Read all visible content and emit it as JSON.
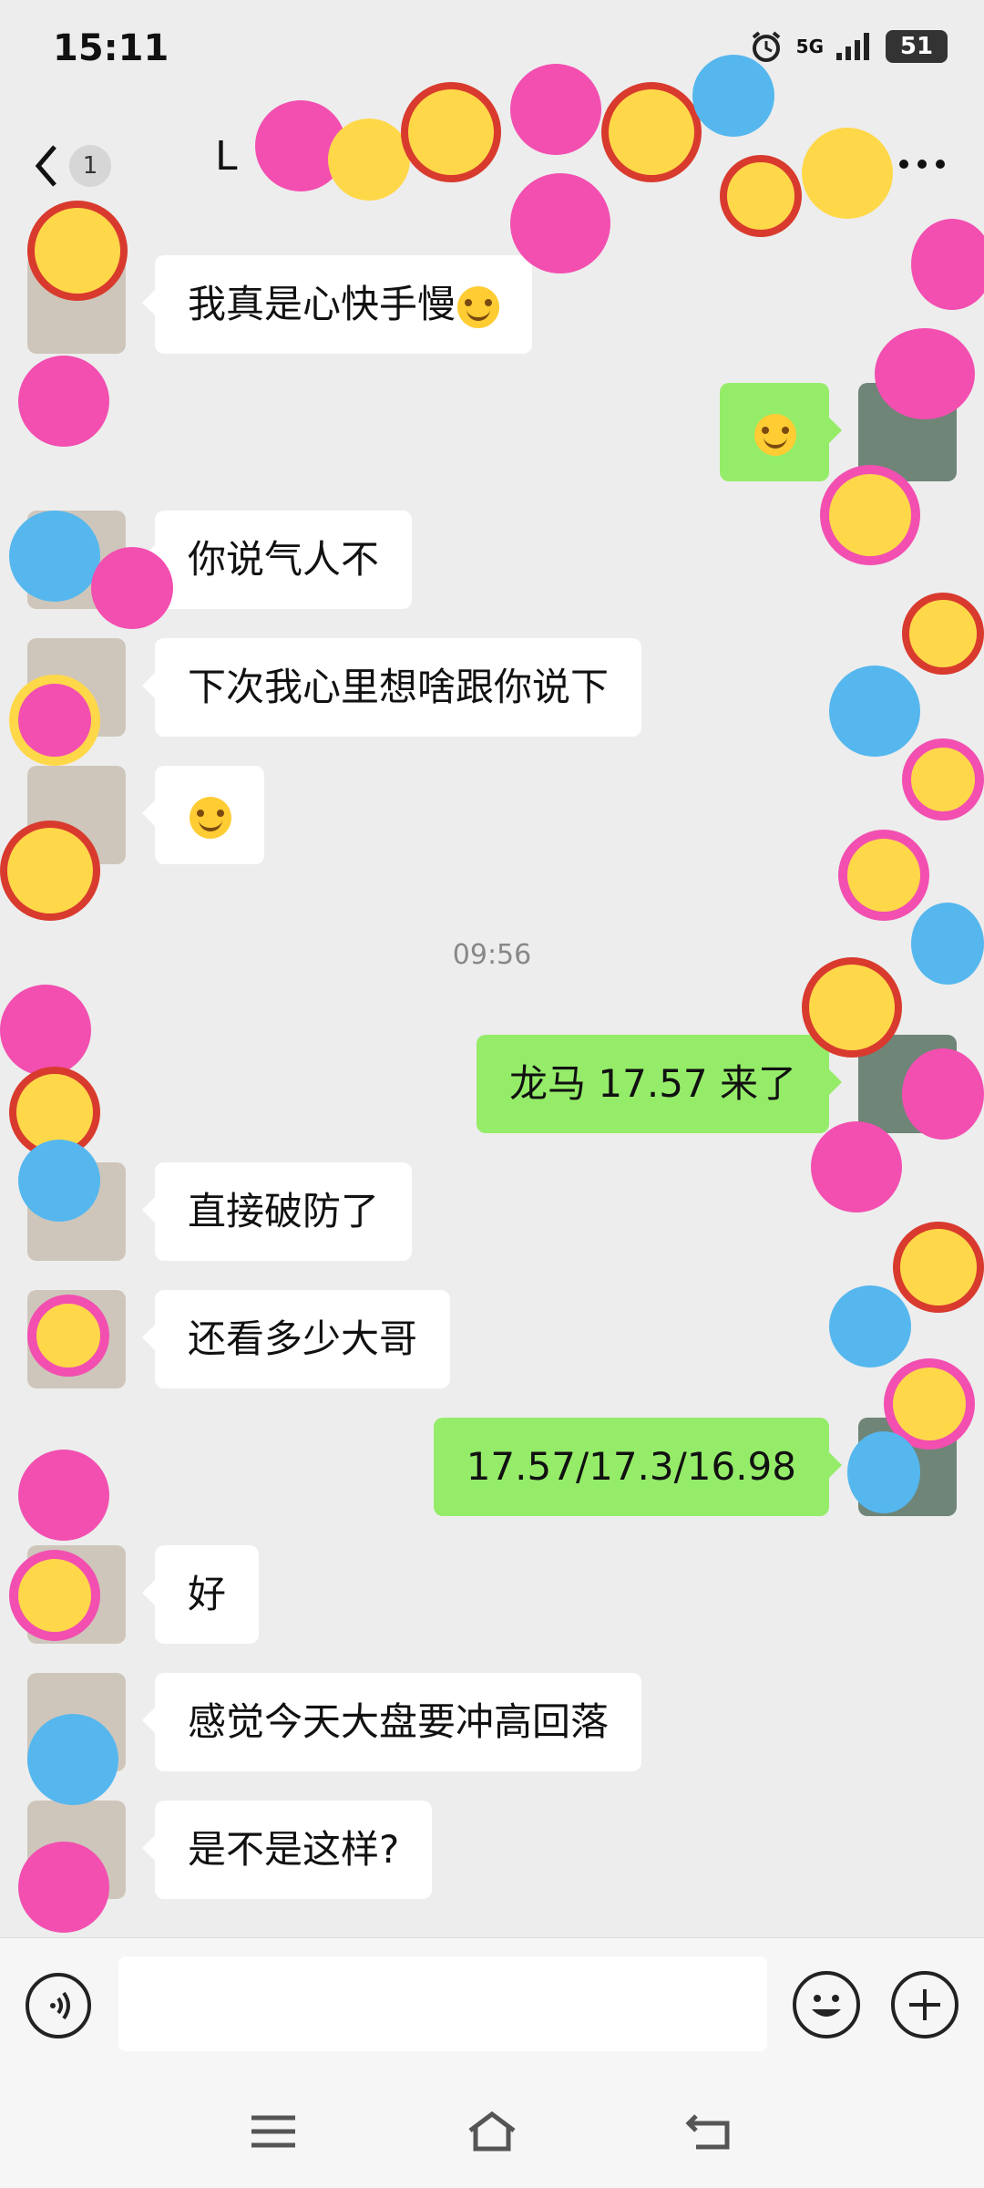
{
  "status_bar": {
    "time": "15:11",
    "network": "5G",
    "battery": "51"
  },
  "navbar": {
    "back_count": "1",
    "title": "L"
  },
  "messages": [
    {
      "side": "in",
      "text": "我真是心快手慢",
      "emoji": "laughing-crying-emoji"
    },
    {
      "side": "out",
      "text": "",
      "emoji": "laughing-crying-emoji"
    },
    {
      "side": "in",
      "text": "你说气人不"
    },
    {
      "side": "in",
      "text": "下次我心里想啥跟你说下"
    },
    {
      "side": "in",
      "text": "",
      "emoji": "laughing-crying-emoji"
    },
    {
      "side": "out",
      "text": "龙马 17.57 来了"
    },
    {
      "side": "in",
      "text": "直接破防了"
    },
    {
      "side": "in",
      "text": "还看多少大哥"
    },
    {
      "side": "out",
      "text": "17.57/17.3/16.98"
    },
    {
      "side": "in",
      "text": "好"
    },
    {
      "side": "in",
      "text": "感觉今天大盘要冲高回落"
    },
    {
      "side": "in",
      "text": "是不是这样?"
    }
  ],
  "timestamp": "09:56",
  "colors": {
    "background": "#ededed",
    "outgoing_bubble": "#95ec69",
    "incoming_bubble": "#ffffff",
    "sticker_pink": "#f24fb0",
    "sticker_yellow": "#ffd84a",
    "sticker_blue": "#55b7ee",
    "sticker_red": "#d93a2e"
  },
  "input": {
    "placeholder": ""
  }
}
